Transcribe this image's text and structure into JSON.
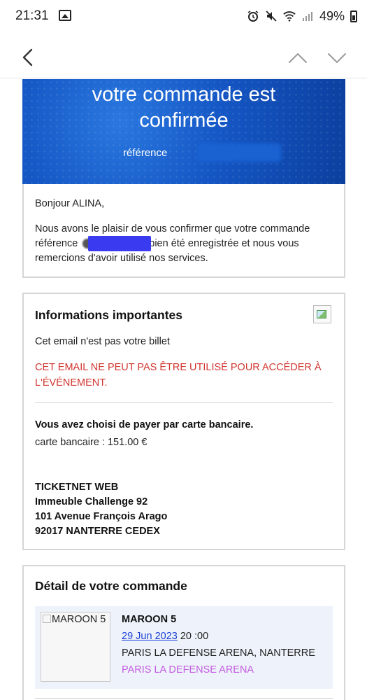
{
  "status_bar": {
    "time": "21:31",
    "battery": "49%",
    "icons": [
      "image-icon",
      "alarm-icon",
      "mute-icon",
      "wifi-icon",
      "signal-icon",
      "battery-icon"
    ]
  },
  "toolbar": {
    "icons": [
      "back-arrow-icon",
      "chevron-up-icon",
      "chevron-down-icon"
    ]
  },
  "hero": {
    "title_line1": "votre commande est",
    "title_line2": "confirmée",
    "reference_label": "référence"
  },
  "intro": {
    "greeting": "Bonjour ALINA,",
    "line1": "Nous avons le plaisir de vous confirmer que votre commande",
    "line2_start": "référence",
    "line2_end": "bien été enregistrée et nous vous",
    "line3": "remercions d'avoir utilisé nos services."
  },
  "info": {
    "title": "Informations importantes",
    "not_ticket": "Cet email n'est pas votre billet",
    "warning_line1": "CET EMAIL NE PEUT PAS ÊTRE UTILISÉ POUR ACCÉDER À",
    "warning_line2": "L'ÉVÉNEMENT.",
    "payment_method": "Vous avez choisi de payer par carte bancaire.",
    "payment_amount": "carte bancaire : 151.00 €",
    "address": [
      "TICKETNET WEB",
      "Immeuble Challenge 92",
      "101 Avenue François Arago",
      "92017 NANTERRE CEDEX"
    ]
  },
  "order": {
    "title": "Détail de votre commande",
    "image_alt": "MAROON 5",
    "artist": "MAROON 5",
    "date": "29 Jun 2023",
    "time": " 20 :00",
    "venue": "PARIS LA DEFENSE ARENA, NANTERRE",
    "venue_link": "PARIS LA DEFENSE ARENA"
  },
  "colors": {
    "hero_blue": "#1456c4",
    "warning_red": "#d0352f",
    "link_blue": "#1a3fd6",
    "venue_purple": "#c35be0",
    "card_bg": "#eef3fb"
  }
}
